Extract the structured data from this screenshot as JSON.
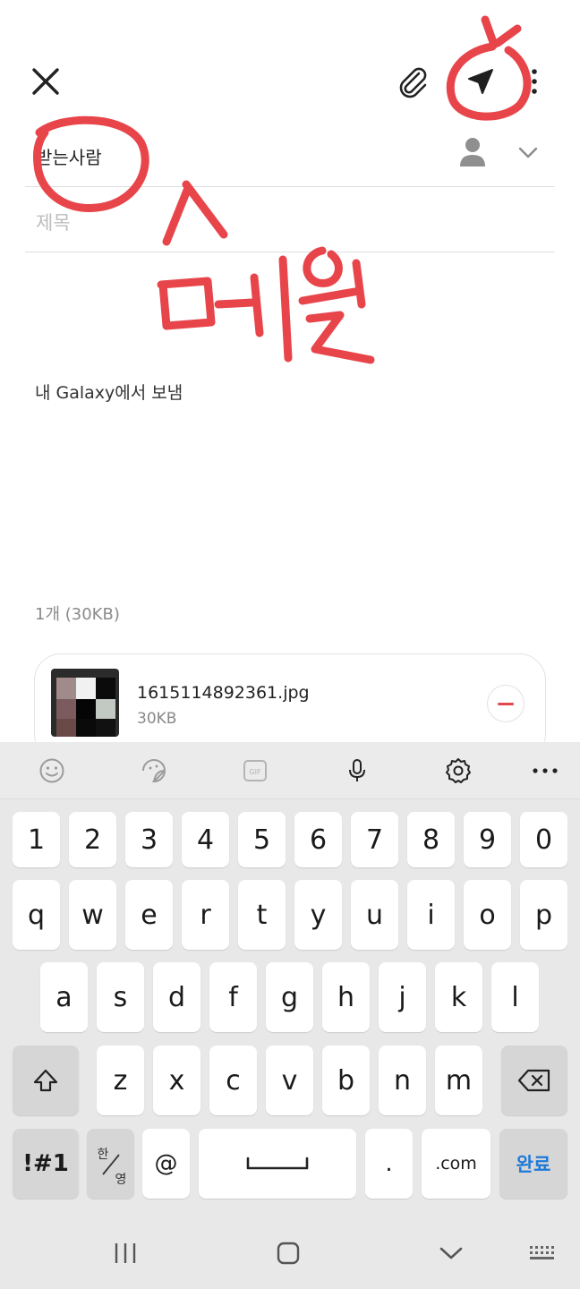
{
  "compose": {
    "to_label": "받는사람",
    "subject_placeholder": "제목",
    "signature": "내 Galaxy에서 보냄",
    "attachment_summary": "1개  (30KB)",
    "attachment": {
      "file_name": "1615114892361.jpg",
      "file_size": "30KB"
    }
  },
  "annotation": {
    "handwritten_text": "메일",
    "color": "#e8454b"
  },
  "keyboard": {
    "toolbar": [
      "emoji-icon",
      "sticker-icon",
      "gif-icon",
      "microphone-icon",
      "settings-icon",
      "more-icon"
    ],
    "gif_label": "GIF",
    "row_numbers": [
      "1",
      "2",
      "3",
      "4",
      "5",
      "6",
      "7",
      "8",
      "9",
      "0"
    ],
    "row_top": [
      "q",
      "w",
      "e",
      "r",
      "t",
      "y",
      "u",
      "i",
      "o",
      "p"
    ],
    "row_middle": [
      "a",
      "s",
      "d",
      "f",
      "g",
      "h",
      "j",
      "k",
      "l"
    ],
    "row_bottom": [
      "z",
      "x",
      "c",
      "v",
      "b",
      "n",
      "m"
    ],
    "symbols_label": "!#1",
    "lang_top": "한",
    "lang_bottom": "영",
    "at_label": "@",
    "period_label": ".",
    "com_label": ".com",
    "done_label": "완료"
  },
  "colors": {
    "accent": "#1e7ad9",
    "remove": "#e2464f",
    "annotation": "#e8454b"
  }
}
